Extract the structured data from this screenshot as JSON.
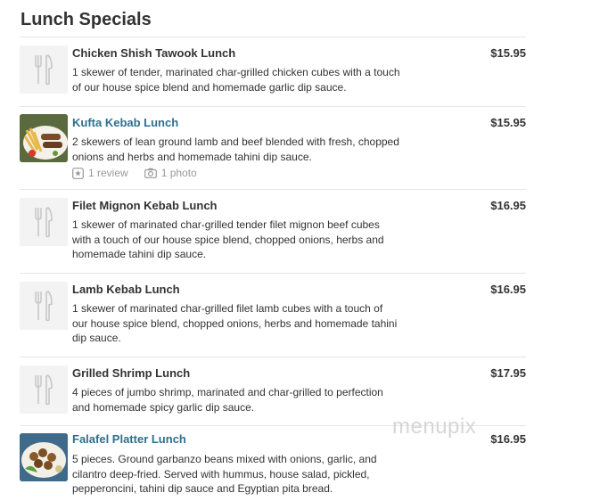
{
  "section_title": "Lunch Specials",
  "items": [
    {
      "name": "Chicken Shish Tawook Lunch",
      "price": "$15.95",
      "description_lines": [
        "1 skewer of tender, marinated char-grilled chicken cubes with a touch",
        "of our house spice blend and homemade garlic dip sauce."
      ],
      "image": "fork-knife-icon"
    },
    {
      "name": "Kufta Kebab Lunch",
      "price": "$15.95",
      "description_lines": [
        "2 skewers of lean ground lamb and beef blended with fresh, chopped",
        "onions and herbs and homemade tahini dip sauce."
      ],
      "image": "food-photo",
      "reviews": "1 review",
      "photos": "1 photo"
    },
    {
      "name": "Filet Mignon Kebab Lunch",
      "price": "$16.95",
      "description_lines": [
        "1 skewer of marinated char-grilled tender filet mignon beef cubes",
        "with a touch of our house spice blend, chopped onions, herbs and",
        "homemade tahini dip sauce."
      ],
      "image": "fork-knife-icon"
    },
    {
      "name": "Lamb Kebab Lunch",
      "price": "$16.95",
      "description_lines": [
        "1 skewer of marinated char-grilled filet lamb cubes with a touch of",
        "our house spice blend, chopped onions, herbs and homemade tahini",
        "dip sauce."
      ],
      "image": "fork-knife-icon"
    },
    {
      "name": "Grilled Shrimp Lunch",
      "price": "$17.95",
      "description_lines": [
        "4 pieces of jumbo shrimp, marinated and char-grilled to perfection",
        "and homemade spicy garlic dip sauce."
      ],
      "image": "fork-knife-icon"
    },
    {
      "name": "Falafel Platter Lunch",
      "price": "$16.95",
      "description_lines": [
        "5 pieces. Ground garbanzo beans mixed with onions, garlic, and",
        "cilantro deep-fried. Served with hummus, house salad, pickled,",
        "pepperoncini, tahini dip sauce and Egyptian pita bread."
      ],
      "image": "food-photo"
    }
  ],
  "watermark": "menupix",
  "colors": {
    "link": "#2e6f8e",
    "text": "#333333",
    "muted": "#999999",
    "divider": "#e6e6e6"
  }
}
